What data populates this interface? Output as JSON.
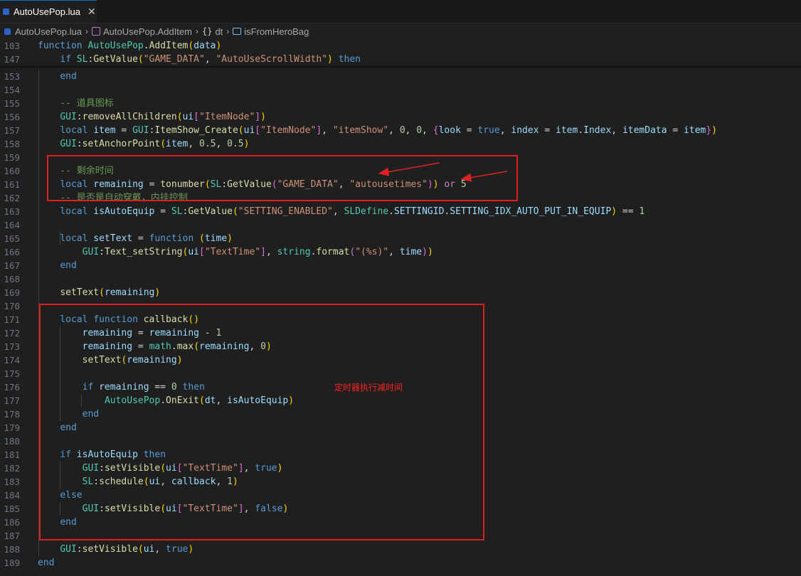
{
  "tab": {
    "title": "AutoUsePop.lua",
    "close_glyph": "✕"
  },
  "breadcrumb": [
    "AutoUsePop.lua",
    "AutoUsePop.AddItem",
    "dt",
    "isFromHeroBag"
  ],
  "sticky": [
    {
      "n": "103",
      "t": "function AutoUsePop.AddItem(data)"
    },
    {
      "n": "147",
      "t": "    if SL:GetValue(\"GAME_DATA\", \"AutoUseScrollWidth\") then"
    }
  ],
  "lines": [
    {
      "n": "153",
      "t": "    end"
    },
    {
      "n": "154",
      "t": ""
    },
    {
      "n": "155",
      "t": "    -- 道具图标"
    },
    {
      "n": "156",
      "t": "    GUI:removeAllChildren(ui[\"ItemNode\"])"
    },
    {
      "n": "157",
      "t": "    local item = GUI:ItemShow_Create(ui[\"ItemNode\"], \"itemShow\", 0, 0, {look = true, index = item.Index, itemData = item})"
    },
    {
      "n": "158",
      "t": "    GUI:setAnchorPoint(item, 0.5, 0.5)"
    },
    {
      "n": "159",
      "t": ""
    },
    {
      "n": "160",
      "t": "    -- 剩余时间"
    },
    {
      "n": "161",
      "t": "    local remaining = tonumber(SL:GetValue(\"GAME_DATA\", \"autousetimes\")) or 5"
    },
    {
      "n": "162",
      "t": "    -- 是否是自动穿戴，内挂控制"
    },
    {
      "n": "163",
      "t": "    local isAutoEquip = SL:GetValue(\"SETTING_ENABLED\", SLDefine.SETTINGID.SETTING_IDX_AUTO_PUT_IN_EQUIP) == 1"
    },
    {
      "n": "164",
      "t": ""
    },
    {
      "n": "165",
      "t": "    local setText = function (time)"
    },
    {
      "n": "166",
      "t": "        GUI:Text_setString(ui[\"TextTime\"], string.format(\"(%s)\", time))"
    },
    {
      "n": "167",
      "t": "    end"
    },
    {
      "n": "168",
      "t": ""
    },
    {
      "n": "169",
      "t": "    setText(remaining)"
    },
    {
      "n": "170",
      "t": ""
    },
    {
      "n": "171",
      "t": "    local function callback()"
    },
    {
      "n": "172",
      "t": "        remaining = remaining - 1"
    },
    {
      "n": "173",
      "t": "        remaining = math.max(remaining, 0)"
    },
    {
      "n": "174",
      "t": "        setText(remaining)"
    },
    {
      "n": "175",
      "t": ""
    },
    {
      "n": "176",
      "t": "        if remaining == 0 then"
    },
    {
      "n": "177",
      "t": "            AutoUsePop.OnExit(dt, isAutoEquip)"
    },
    {
      "n": "178",
      "t": "        end"
    },
    {
      "n": "179",
      "t": "    end"
    },
    {
      "n": "180",
      "t": ""
    },
    {
      "n": "181",
      "t": "    if isAutoEquip then"
    },
    {
      "n": "182",
      "t": "        GUI:setVisible(ui[\"TextTime\"], true)"
    },
    {
      "n": "183",
      "t": "        SL:schedule(ui, callback, 1)"
    },
    {
      "n": "184",
      "t": "    else"
    },
    {
      "n": "185",
      "t": "        GUI:setVisible(ui[\"TextTime\"], false)"
    },
    {
      "n": "186",
      "t": "    end"
    },
    {
      "n": "187",
      "t": ""
    },
    {
      "n": "188",
      "t": "    GUI:setVisible(ui, true)"
    },
    {
      "n": "189",
      "t": "end"
    }
  ],
  "annotation": {
    "text": "定时器执行减时间"
  },
  "colors": {
    "highlight_box": "#e02020",
    "background": "#1f1f1f",
    "keyword": "#569cd6",
    "string": "#ce9178",
    "comment": "#6a9955",
    "function": "#dcdcaa"
  },
  "icons": {
    "file": "lua-file-icon",
    "method": "cube-icon",
    "namespace": "braces-icon",
    "field": "field-icon"
  }
}
